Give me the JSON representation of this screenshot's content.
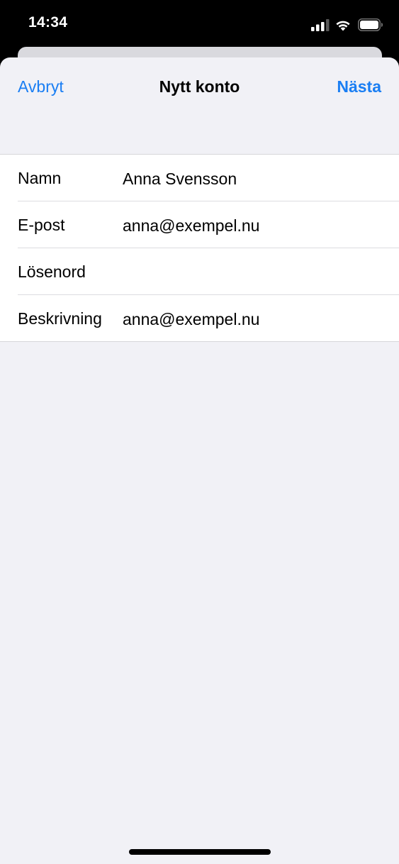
{
  "status_bar": {
    "time": "14:34",
    "icons": [
      "cellular-signal-icon",
      "wifi-icon",
      "battery-icon"
    ]
  },
  "nav": {
    "cancel_label": "Avbryt",
    "title": "Nytt konto",
    "next_label": "Nästa"
  },
  "form": {
    "rows": [
      {
        "label": "Namn",
        "value": "Anna Svensson"
      },
      {
        "label": "E-post",
        "value": "anna@exempel.nu"
      },
      {
        "label": "Lösenord",
        "value": ""
      },
      {
        "label": "Beskrivning",
        "value": "anna@exempel.nu"
      }
    ]
  },
  "colors": {
    "accent": "#1a7ef3",
    "sheet_background": "#f1f1f6",
    "group_background": "#ffffff",
    "status_bar_background": "#000000"
  }
}
